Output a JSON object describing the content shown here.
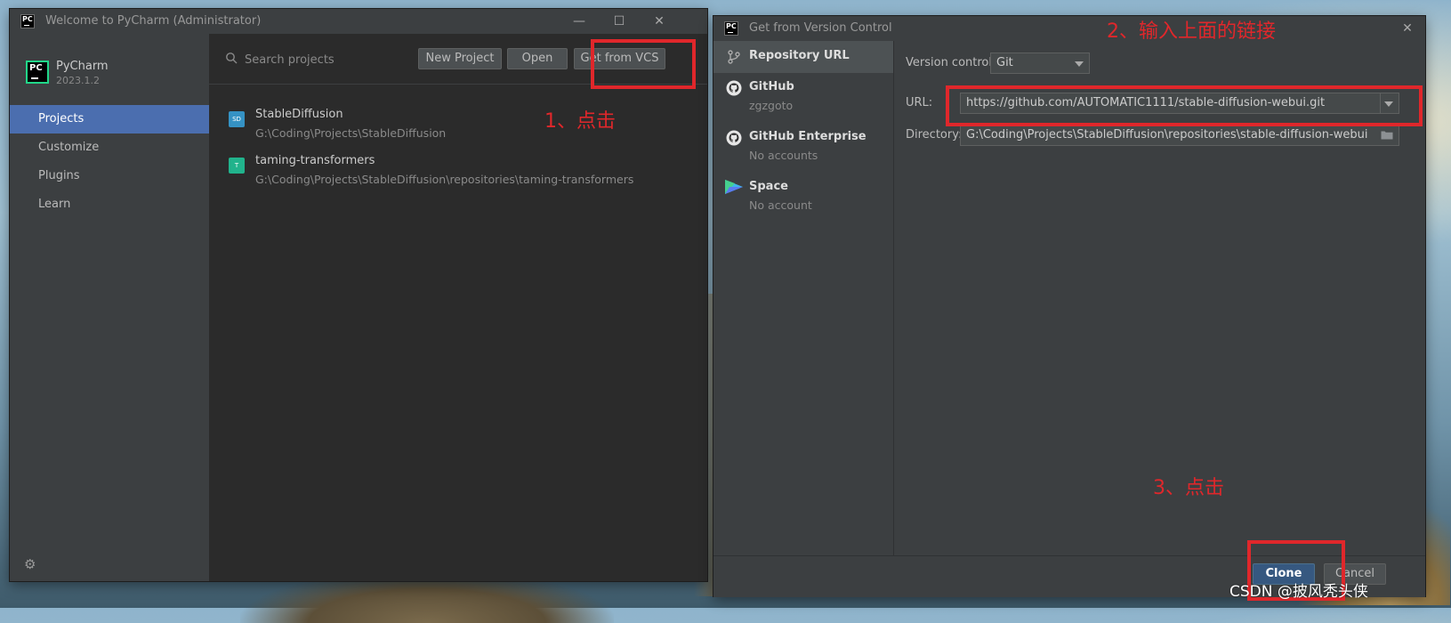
{
  "welcome": {
    "window_title": "Welcome to PyCharm (Administrator)",
    "product": {
      "name": "PyCharm",
      "version": "2023.1.2"
    },
    "nav": [
      "Projects",
      "Customize",
      "Plugins",
      "Learn"
    ],
    "selected_nav": "Projects",
    "search": {
      "placeholder": "Search projects"
    },
    "buttons": {
      "new_project": "New Project",
      "open": "Open",
      "get_from_vcs": "Get from VCS"
    },
    "projects": [
      {
        "badge": "SD",
        "name": "StableDiffusion",
        "path": "G:\\Coding\\Projects\\StableDiffusion",
        "color": "#3592c4"
      },
      {
        "badge": "T",
        "name": "taming-transformers",
        "path": "G:\\Coding\\Projects\\StableDiffusion\\repositories\\taming-transformers",
        "color": "#21b38c"
      }
    ]
  },
  "vcs": {
    "window_title": "Get from Version Control",
    "sources": [
      {
        "name": "Repository URL",
        "sub": ""
      },
      {
        "name": "GitHub",
        "sub": "zgzgoto"
      },
      {
        "name": "GitHub Enterprise",
        "sub": "No accounts"
      },
      {
        "name": "Space",
        "sub": "No account"
      }
    ],
    "version_control": {
      "label": "Version control:",
      "value": "Git"
    },
    "url": {
      "label": "URL:",
      "value": "https://github.com/AUTOMATIC1111/stable-diffusion-webui.git"
    },
    "directory": {
      "label": "Directory:",
      "value": "G:\\Coding\\Projects\\StableDiffusion\\repositories\\stable-diffusion-webui"
    },
    "buttons": {
      "clone": "Clone",
      "cancel": "Cancel"
    }
  },
  "annotations": {
    "step1": "1、点击",
    "step2": "2、输入上面的链接",
    "step3": "3、点击",
    "color": "#e0272b"
  },
  "watermark": "CSDN @披风秃头侠"
}
